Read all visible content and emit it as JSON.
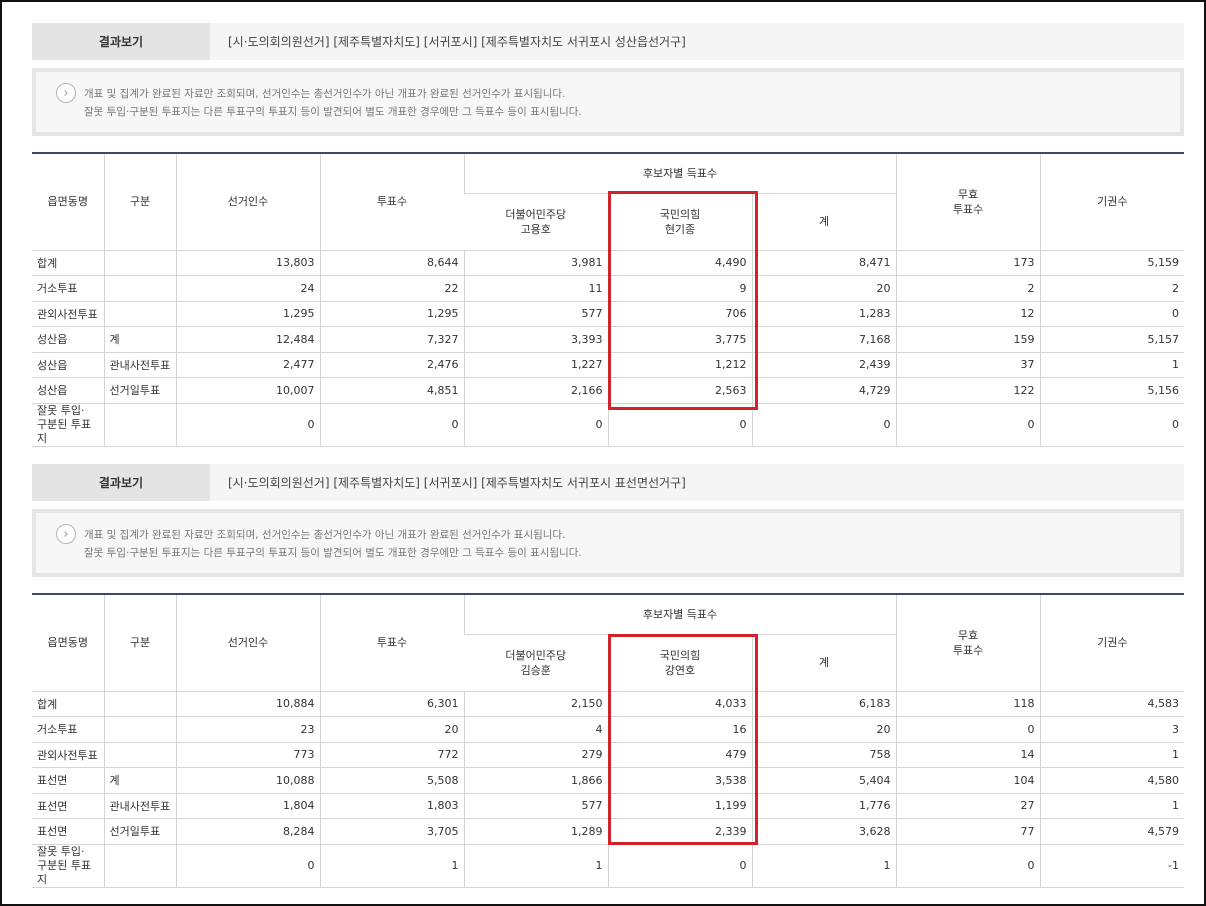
{
  "sections": [
    {
      "result_label": "결과보기",
      "result_path": "[시·도의회의원선거] [제주특별자치도] [서귀포시] [제주특별자치도 서귀포시 성산읍선거구]",
      "notice_icon": "chevron-right-icon",
      "notice_line1": "개표 및 집계가 완료된 자료만 조회되며, 선거인수는 총선거인수가 아닌 개표가 완료된 선거인수가 표시됩니다.",
      "notice_line2": "잘못 투입·구분된 투표지는 다른 투표구의 투표지 등이 발견되어 별도 개표한 경우에만 그 득표수 등이 표시됩니다.",
      "headers": {
        "district": "읍면동명",
        "category": "구분",
        "electorate": "선거인수",
        "votes": "투표수",
        "candidate_group": "후보자별 득표수",
        "cand1_party": "더불어민주당",
        "cand1_name": "고용호",
        "cand2_party": "국민의힘",
        "cand2_name": "현기종",
        "total": "계",
        "invalid_1": "무효",
        "invalid_2": "투표수",
        "abstain": "기권수"
      },
      "rows": [
        {
          "district": "합계",
          "category": "",
          "electorate": "13,803",
          "votes": "8,644",
          "cand1": "3,981",
          "cand2": "4,490",
          "total": "8,471",
          "invalid": "173",
          "abstain": "5,159"
        },
        {
          "district": "거소투표",
          "category": "",
          "electorate": "24",
          "votes": "22",
          "cand1": "11",
          "cand2": "9",
          "total": "20",
          "invalid": "2",
          "abstain": "2"
        },
        {
          "district": "관외사전투표",
          "category": "",
          "electorate": "1,295",
          "votes": "1,295",
          "cand1": "577",
          "cand2": "706",
          "total": "1,283",
          "invalid": "12",
          "abstain": "0"
        },
        {
          "district": "성산읍",
          "category": "계",
          "electorate": "12,484",
          "votes": "7,327",
          "cand1": "3,393",
          "cand2": "3,775",
          "total": "7,168",
          "invalid": "159",
          "abstain": "5,157"
        },
        {
          "district": "성산읍",
          "category": "관내사전투표",
          "electorate": "2,477",
          "votes": "2,476",
          "cand1": "1,227",
          "cand2": "1,212",
          "total": "2,439",
          "invalid": "37",
          "abstain": "1"
        },
        {
          "district": "성산읍",
          "category": "선거일투표",
          "electorate": "10,007",
          "votes": "4,851",
          "cand1": "2,166",
          "cand2": "2,563",
          "total": "4,729",
          "invalid": "122",
          "abstain": "5,156"
        }
      ],
      "misplaced": {
        "label1": "잘못 투입·",
        "label2": "구분된 투표지",
        "electorate": "0",
        "votes": "0",
        "cand1": "0",
        "cand2": "0",
        "total": "0",
        "invalid": "0",
        "abstain": "0"
      }
    },
    {
      "result_label": "결과보기",
      "result_path": "[시·도의회의원선거] [제주특별자치도] [서귀포시] [제주특별자치도 서귀포시 표선면선거구]",
      "notice_icon": "chevron-right-icon",
      "notice_line1": "개표 및 집계가 완료된 자료만 조회되며, 선거인수는 총선거인수가 아닌 개표가 완료된 선거인수가 표시됩니다.",
      "notice_line2": "잘못 투입·구분된 투표지는 다른 투표구의 투표지 등이 발견되어 별도 개표한 경우에만 그 득표수 등이 표시됩니다.",
      "headers": {
        "district": "읍면동명",
        "category": "구분",
        "electorate": "선거인수",
        "votes": "투표수",
        "candidate_group": "후보자별 득표수",
        "cand1_party": "더불어민주당",
        "cand1_name": "김승훈",
        "cand2_party": "국민의힘",
        "cand2_name": "강연호",
        "total": "계",
        "invalid_1": "무효",
        "invalid_2": "투표수",
        "abstain": "기권수"
      },
      "rows": [
        {
          "district": "합계",
          "category": "",
          "electorate": "10,884",
          "votes": "6,301",
          "cand1": "2,150",
          "cand2": "4,033",
          "total": "6,183",
          "invalid": "118",
          "abstain": "4,583"
        },
        {
          "district": "거소투표",
          "category": "",
          "electorate": "23",
          "votes": "20",
          "cand1": "4",
          "cand2": "16",
          "total": "20",
          "invalid": "0",
          "abstain": "3"
        },
        {
          "district": "관외사전투표",
          "category": "",
          "electorate": "773",
          "votes": "772",
          "cand1": "279",
          "cand2": "479",
          "total": "758",
          "invalid": "14",
          "abstain": "1"
        },
        {
          "district": "표선면",
          "category": "계",
          "electorate": "10,088",
          "votes": "5,508",
          "cand1": "1,866",
          "cand2": "3,538",
          "total": "5,404",
          "invalid": "104",
          "abstain": "4,580"
        },
        {
          "district": "표선면",
          "category": "관내사전투표",
          "electorate": "1,804",
          "votes": "1,803",
          "cand1": "577",
          "cand2": "1,199",
          "total": "1,776",
          "invalid": "27",
          "abstain": "1"
        },
        {
          "district": "표선면",
          "category": "선거일투표",
          "electorate": "8,284",
          "votes": "3,705",
          "cand1": "1,289",
          "cand2": "2,339",
          "total": "3,628",
          "invalid": "77",
          "abstain": "4,579"
        }
      ],
      "misplaced": {
        "label1": "잘못 투입·",
        "label2": "구분된 투표지",
        "electorate": "0",
        "votes": "1",
        "cand1": "1",
        "cand2": "0",
        "total": "1",
        "invalid": "0",
        "abstain": "-1"
      }
    }
  ],
  "highlight_color": "#d0232b",
  "header_rule_color": "#3b4a6b"
}
